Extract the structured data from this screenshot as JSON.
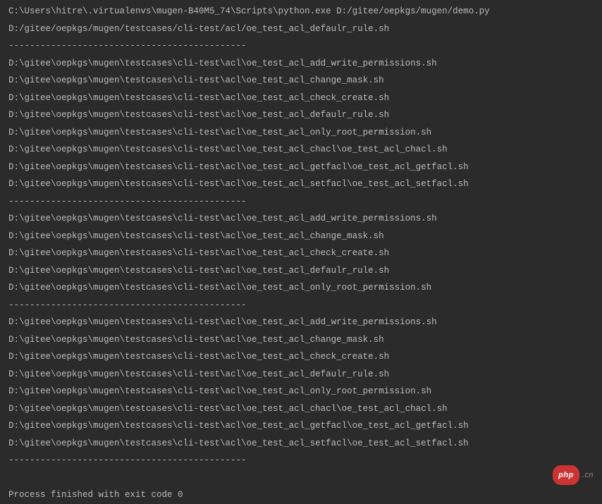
{
  "console": {
    "command": "C:\\Users\\hitre\\.virtualenvs\\mugen-B40M5_74\\Scripts\\python.exe D:/gitee/oepkgs/mugen/demo.py",
    "header_path": "D:/gitee/oepkgs/mugen/testcases/cli-test/acl/oe_test_acl_defaulr_rule.sh",
    "separator": "---------------------------------------------",
    "group1": [
      "D:\\gitee\\oepkgs\\mugen\\testcases\\cli-test\\acl\\oe_test_acl_add_write_permissions.sh",
      "D:\\gitee\\oepkgs\\mugen\\testcases\\cli-test\\acl\\oe_test_acl_change_mask.sh",
      "D:\\gitee\\oepkgs\\mugen\\testcases\\cli-test\\acl\\oe_test_acl_check_create.sh",
      "D:\\gitee\\oepkgs\\mugen\\testcases\\cli-test\\acl\\oe_test_acl_defaulr_rule.sh",
      "D:\\gitee\\oepkgs\\mugen\\testcases\\cli-test\\acl\\oe_test_acl_only_root_permission.sh",
      "D:\\gitee\\oepkgs\\mugen\\testcases\\cli-test\\acl\\oe_test_acl_chacl\\oe_test_acl_chacl.sh",
      "D:\\gitee\\oepkgs\\mugen\\testcases\\cli-test\\acl\\oe_test_acl_getfacl\\oe_test_acl_getfacl.sh",
      "D:\\gitee\\oepkgs\\mugen\\testcases\\cli-test\\acl\\oe_test_acl_setfacl\\oe_test_acl_setfacl.sh"
    ],
    "group2": [
      "D:\\gitee\\oepkgs\\mugen\\testcases\\cli-test\\acl\\oe_test_acl_add_write_permissions.sh",
      "D:\\gitee\\oepkgs\\mugen\\testcases\\cli-test\\acl\\oe_test_acl_change_mask.sh",
      "D:\\gitee\\oepkgs\\mugen\\testcases\\cli-test\\acl\\oe_test_acl_check_create.sh",
      "D:\\gitee\\oepkgs\\mugen\\testcases\\cli-test\\acl\\oe_test_acl_defaulr_rule.sh",
      "D:\\gitee\\oepkgs\\mugen\\testcases\\cli-test\\acl\\oe_test_acl_only_root_permission.sh"
    ],
    "group3": [
      "D:\\gitee\\oepkgs\\mugen\\testcases\\cli-test\\acl\\oe_test_acl_add_write_permissions.sh",
      "D:\\gitee\\oepkgs\\mugen\\testcases\\cli-test\\acl\\oe_test_acl_change_mask.sh",
      "D:\\gitee\\oepkgs\\mugen\\testcases\\cli-test\\acl\\oe_test_acl_check_create.sh",
      "D:\\gitee\\oepkgs\\mugen\\testcases\\cli-test\\acl\\oe_test_acl_defaulr_rule.sh",
      "D:\\gitee\\oepkgs\\mugen\\testcases\\cli-test\\acl\\oe_test_acl_only_root_permission.sh",
      "D:\\gitee\\oepkgs\\mugen\\testcases\\cli-test\\acl\\oe_test_acl_chacl\\oe_test_acl_chacl.sh",
      "D:\\gitee\\oepkgs\\mugen\\testcases\\cli-test\\acl\\oe_test_acl_getfacl\\oe_test_acl_getfacl.sh",
      "D:\\gitee\\oepkgs\\mugen\\testcases\\cli-test\\acl\\oe_test_acl_setfacl\\oe_test_acl_setfacl.sh"
    ],
    "exit_message": "Process finished with exit code 0"
  },
  "watermark": {
    "badge": "php",
    "suffix": ".cn"
  }
}
